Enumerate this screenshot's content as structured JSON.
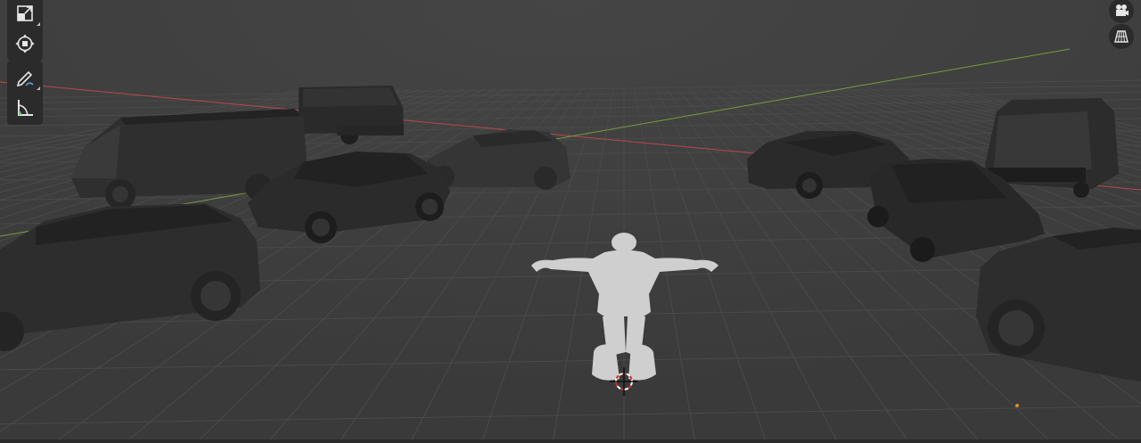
{
  "app": "3D viewport",
  "colors": {
    "background": "#3d3d3d",
    "grid": "#4a4a4a",
    "x_axis": "#b8474f",
    "y_axis": "#7a9a3d",
    "car_body": "#2e2e2e",
    "character": "#cfcfcf"
  },
  "toolbar": {
    "groups": [
      {
        "tools": [
          {
            "icon": "scale-icon",
            "has_submenu": true
          },
          {
            "icon": "transform-icon",
            "has_submenu": false
          }
        ]
      },
      {
        "tools": [
          {
            "icon": "annotate-icon",
            "has_submenu": true
          },
          {
            "icon": "measure-icon",
            "has_submenu": false
          }
        ]
      }
    ]
  },
  "navigation": {
    "buttons": [
      {
        "icon": "camera-view-icon"
      },
      {
        "icon": "ortho-grid-icon"
      }
    ]
  },
  "scene": {
    "objects": [
      "van-left",
      "van-back",
      "car-left-front",
      "car-center-left",
      "car-center-back",
      "car-right-back",
      "van-right",
      "car-right-middle",
      "car-right-front",
      "character",
      "3d-cursor"
    ]
  }
}
